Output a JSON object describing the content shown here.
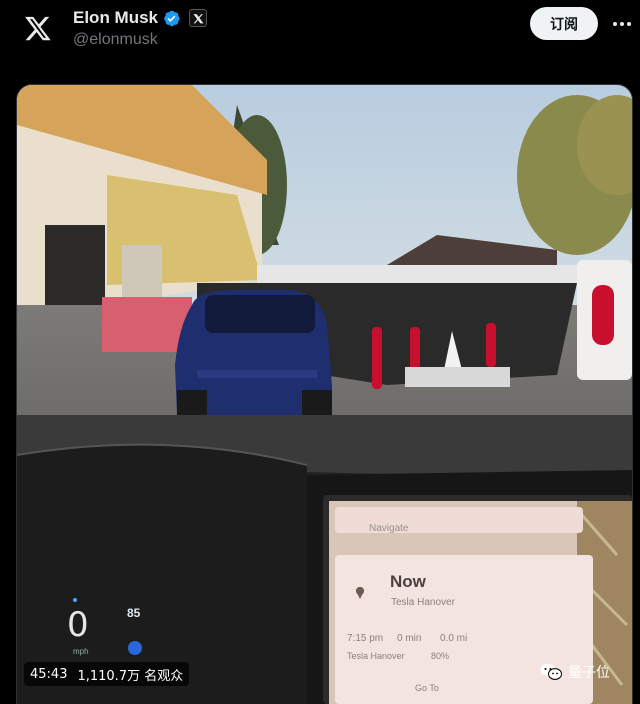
{
  "author": {
    "name": "Elon Musk",
    "handle": "@elonmusk",
    "verified_icon": "verified-badge-icon",
    "affiliation_icon": "x-affiliate-badge-icon"
  },
  "header": {
    "logo_icon": "x-logo-icon",
    "subscribe_label": "订阅",
    "more_icon": "more-options-icon"
  },
  "video": {
    "duration": "45:43",
    "views": "1,110.7万 名观众",
    "dashboard": {
      "speed": "0",
      "speed_unit": "mph",
      "speed_limit": "85"
    },
    "nav_screen": {
      "search_placeholder": "Navigate",
      "now_label": "Now",
      "destination": "Tesla Hanover",
      "time": "7:15 pm",
      "minutes": "0 min",
      "distance": "0.0 mi",
      "destination_repeat": "Tesla Hanover",
      "battery": "80%",
      "bottom_button": "Go To"
    }
  },
  "watermark": {
    "text": "量子位",
    "icon": "wechat-icon"
  },
  "colors": {
    "background": "#000000",
    "subscribe_bg": "#eff3f4",
    "verified_blue": "#1d9bf0",
    "car_blue": "#1f2e6e",
    "charger_red": "#c8102e"
  }
}
